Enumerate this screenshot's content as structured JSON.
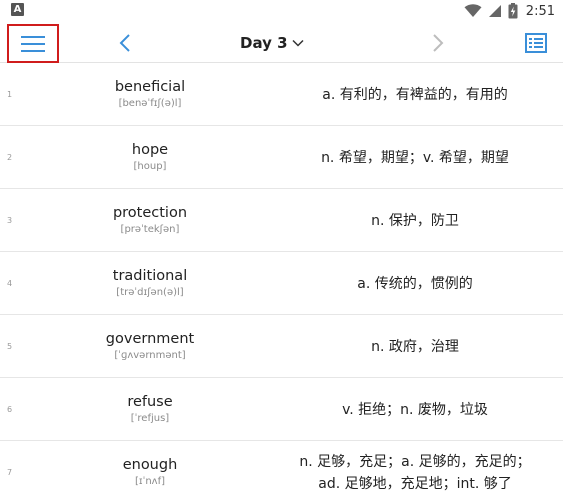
{
  "status_bar": {
    "time": "2:51",
    "notification_letter": "A"
  },
  "toolbar": {
    "title": "Day 3",
    "accent_color": "#3a8fd9"
  },
  "words": [
    {
      "index": "1",
      "word": "beneficial",
      "phonetic": "[benəˈfɪʃ(ə)l]",
      "definition": [
        "a. 有利的，有裨益的，有用的"
      ]
    },
    {
      "index": "2",
      "word": "hope",
      "phonetic": "[houp]",
      "definition": [
        "n. 希望，期望；v. 希望，期望"
      ]
    },
    {
      "index": "3",
      "word": "protection",
      "phonetic": "[prəˈtekʃən]",
      "definition": [
        "n. 保护，防卫"
      ]
    },
    {
      "index": "4",
      "word": "traditional",
      "phonetic": "[trəˈdɪʃən(ə)l]",
      "definition": [
        "a. 传统的，惯例的"
      ]
    },
    {
      "index": "5",
      "word": "government",
      "phonetic": "[ˈɡʌvərnmənt]",
      "definition": [
        "n. 政府，治理"
      ]
    },
    {
      "index": "6",
      "word": "refuse",
      "phonetic": "[ˈrefjus]",
      "definition": [
        "v. 拒绝；n. 废物，垃圾"
      ]
    },
    {
      "index": "7",
      "word": "enough",
      "phonetic": "[ɪˈnʌf]",
      "definition": [
        "n. 足够，充足；a. 足够的，充足的；",
        "ad. 足够地，充足地；int. 够了"
      ]
    }
  ]
}
